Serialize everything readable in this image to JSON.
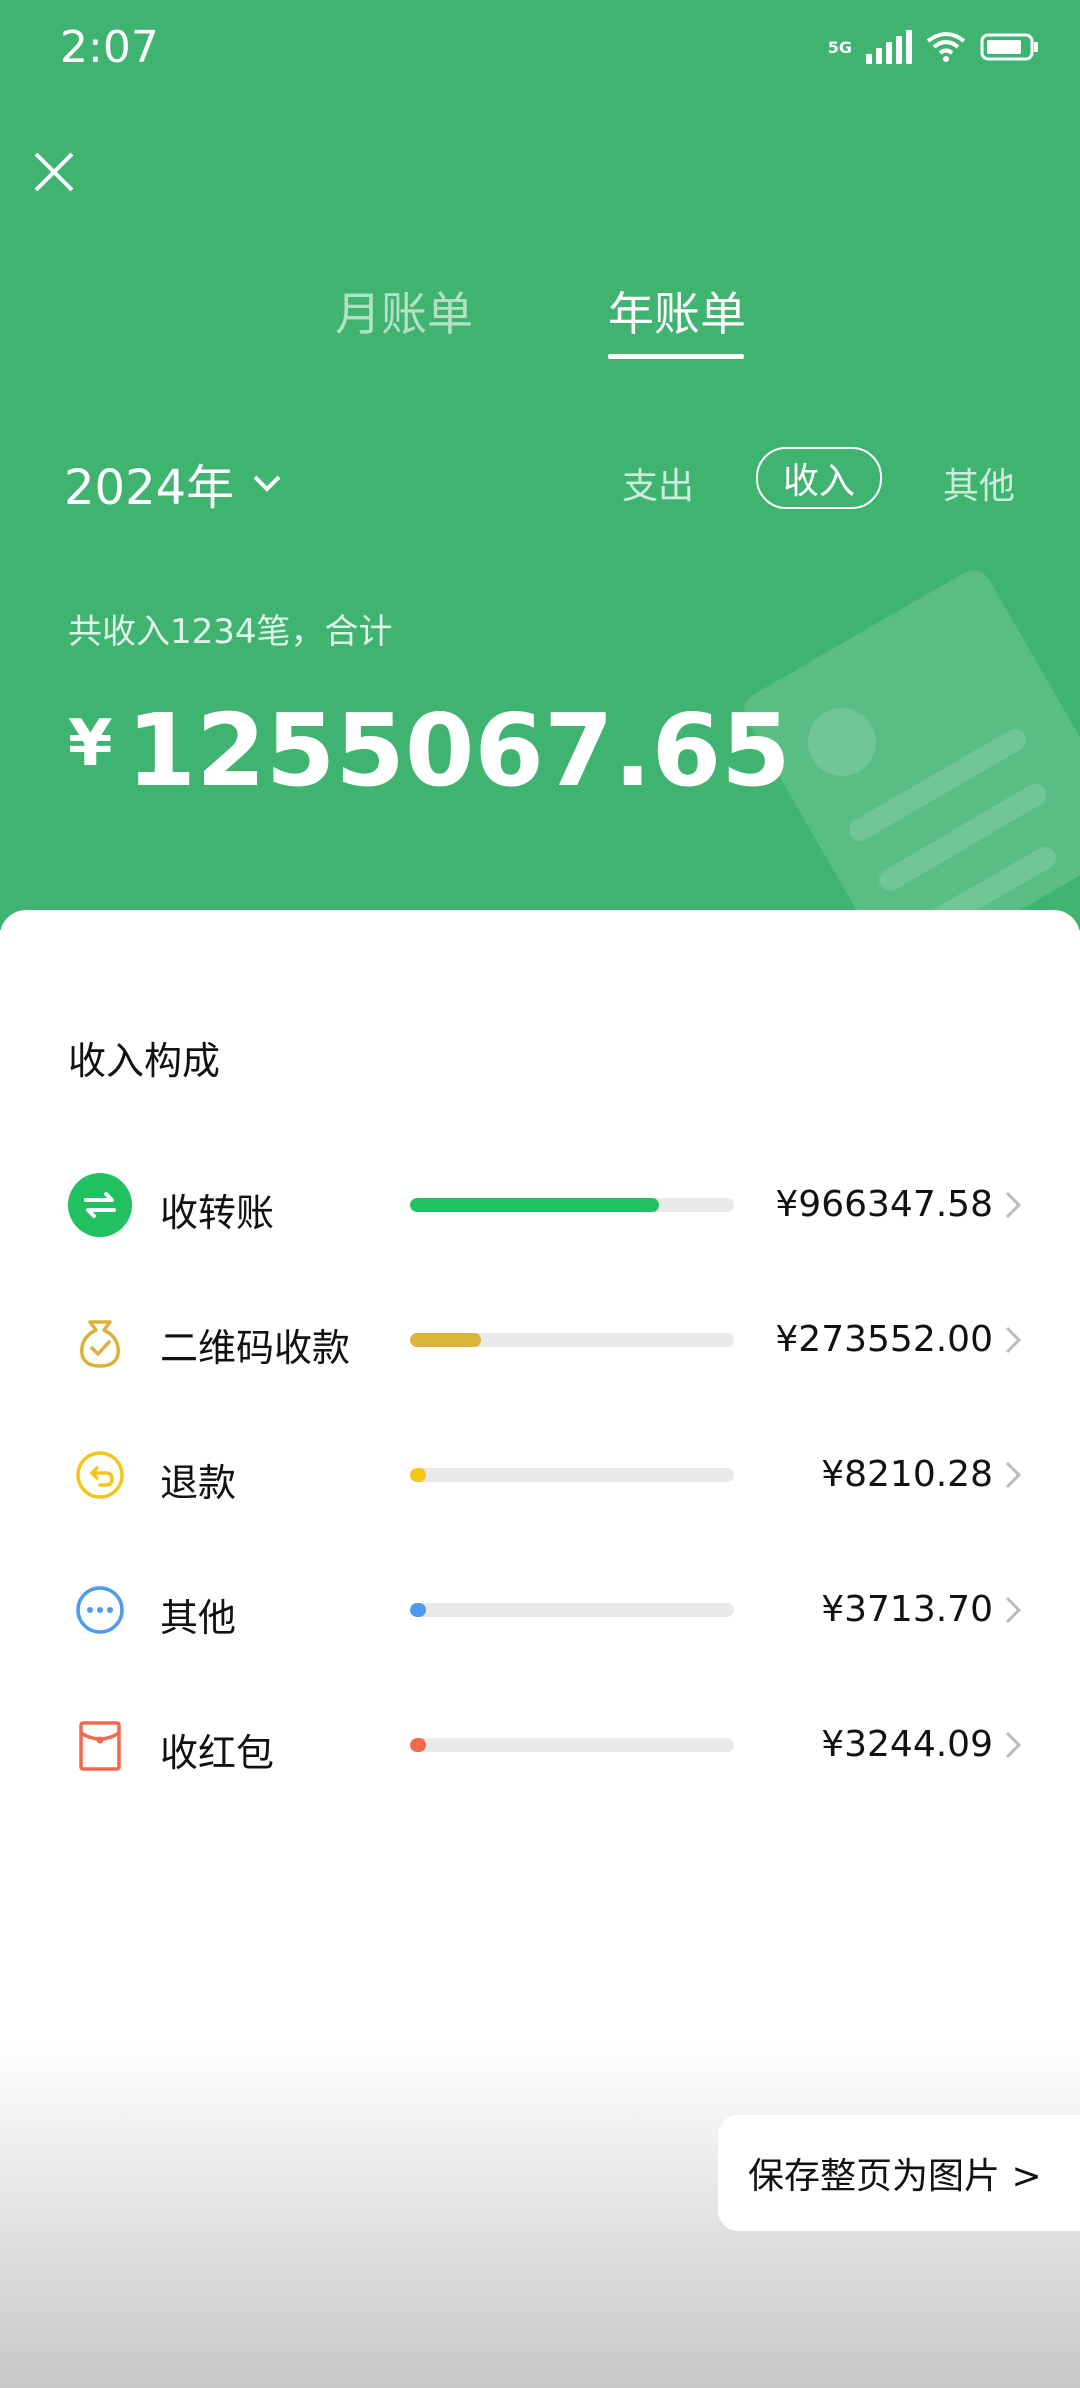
{
  "status": {
    "time": "2:07",
    "network": "5G"
  },
  "header": {
    "close_icon": "close-icon",
    "tabs": [
      {
        "label": "月账单",
        "active": false
      },
      {
        "label": "年账单",
        "active": true
      }
    ],
    "year_label": "2024年",
    "filters": [
      {
        "label": "支出",
        "active": false
      },
      {
        "label": "收入",
        "active": true
      },
      {
        "label": "其他",
        "active": false
      }
    ],
    "summary_text": "共收入1234笔，合计",
    "currency_symbol": "¥",
    "total_amount": "1255067.65",
    "background_color": "#3fb370"
  },
  "income": {
    "title": "收入构成",
    "items": [
      {
        "label": "收转账",
        "amount": "¥966347.58",
        "fraction": 0.77,
        "color": "#1fc161",
        "icon": "transfer-icon"
      },
      {
        "label": "二维码收款",
        "amount": "¥273552.00",
        "fraction": 0.22,
        "color": "#dcb33a",
        "icon": "money-bag-icon"
      },
      {
        "label": "退款",
        "amount": "¥8210.28",
        "fraction": 0.007,
        "color": "#f5c518",
        "icon": "refund-icon"
      },
      {
        "label": "其他",
        "amount": "¥3713.70",
        "fraction": 0.003,
        "color": "#4c9bf0",
        "icon": "more-icon"
      },
      {
        "label": "收红包",
        "amount": "¥3244.09",
        "fraction": 0.003,
        "color": "#f06a4f",
        "icon": "red-packet-icon"
      }
    ]
  },
  "save_button": {
    "label": "保存整页为图片 >"
  }
}
